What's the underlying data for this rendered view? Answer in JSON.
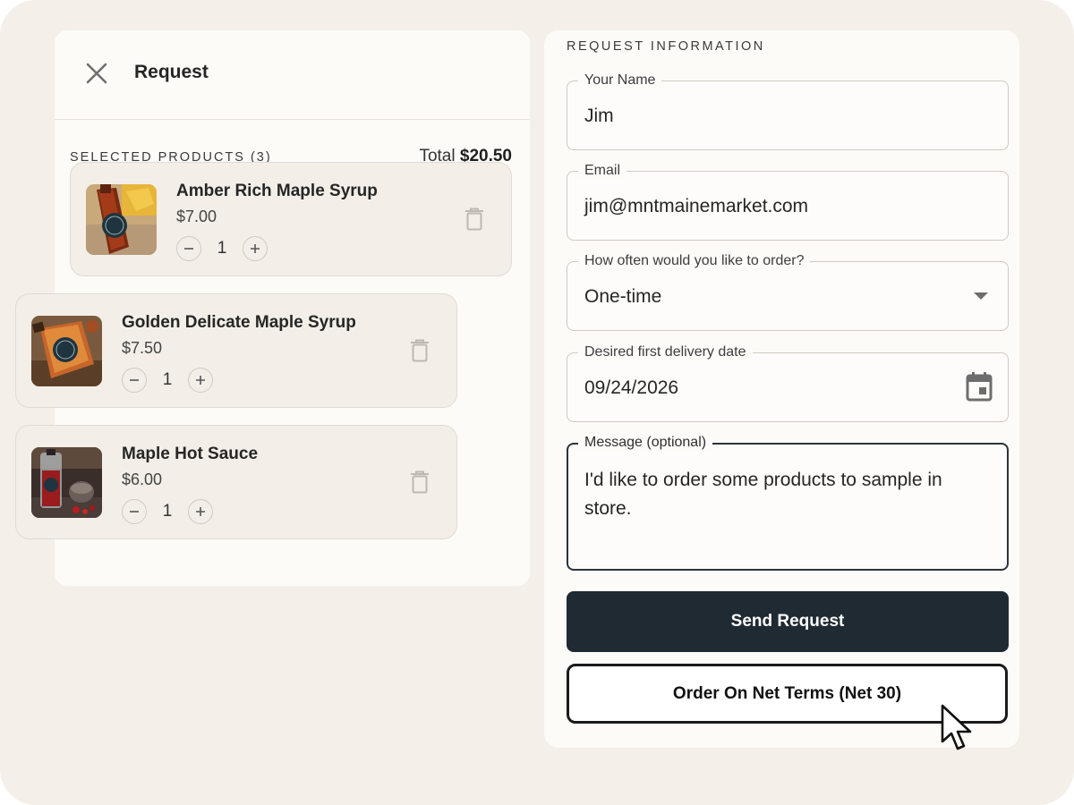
{
  "left_panel": {
    "title": "Request",
    "close_icon": "close-icon",
    "selected_label": "SELECTED PRODUCTS (3)",
    "total_prefix": "Total",
    "total_amount": "$20.50",
    "products": [
      {
        "name": "Amber Rich Maple Syrup",
        "price": "$7.00",
        "quantity": "1"
      },
      {
        "name": "Golden Delicate Maple Syrup",
        "price": "$7.50",
        "quantity": "1"
      },
      {
        "name": "Maple Hot Sauce",
        "price": "$6.00",
        "quantity": "1"
      }
    ],
    "minus_symbol": "−",
    "plus_symbol": "+"
  },
  "right_panel": {
    "section_label": "REQUEST INFORMATION",
    "name": {
      "label": "Your Name",
      "value": "Jim"
    },
    "email": {
      "label": "Email",
      "value": "jim@mntmainemarket.com"
    },
    "frequency": {
      "label": "How often would you like to order?",
      "value": "One-time"
    },
    "delivery_date": {
      "label": "Desired first delivery date",
      "value": "09/24/2026"
    },
    "message": {
      "label": "Message (optional)",
      "value": "I'd like to order some products to sample in store."
    },
    "send_button": "Send Request",
    "net_terms_button": "Order On Net Terms (Net 30)"
  },
  "colors": {
    "background": "#f4efe8",
    "panel": "#fcfbf8",
    "primary_button": "#1f2a33",
    "card": "#f3efe8"
  }
}
